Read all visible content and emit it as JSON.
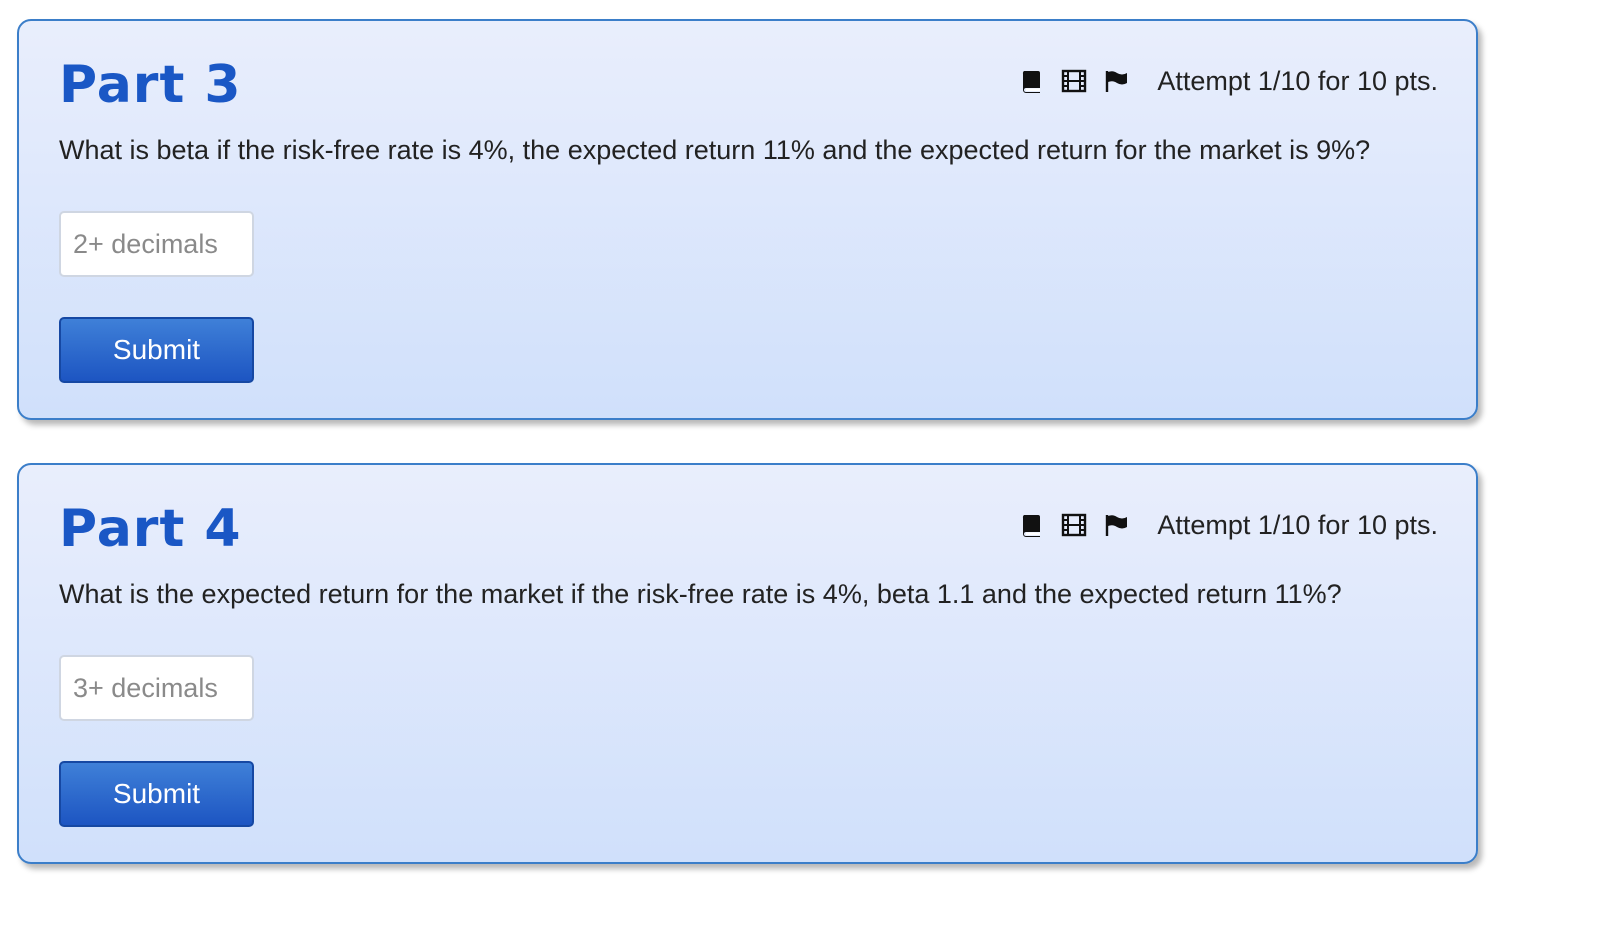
{
  "parts": [
    {
      "title": "Part 3",
      "attempt": "Attempt 1/10 for 10 pts.",
      "question": "What is beta if the risk-free rate is 4%, the expected return 11% and the expected return for the market is 9%?",
      "input": {
        "placeholder": "2+ decimals",
        "value": ""
      },
      "submit_label": "Submit",
      "icons": [
        "book-icon",
        "film-icon",
        "flag-icon"
      ]
    },
    {
      "title": "Part 4",
      "attempt": "Attempt 1/10 for 10 pts.",
      "question": "What is the expected return for the market if the risk-free rate is 4%, beta 1.1 and the expected return 11%?",
      "input": {
        "placeholder": "3+ decimals",
        "value": ""
      },
      "submit_label": "Submit",
      "icons": [
        "book-icon",
        "film-icon",
        "flag-icon"
      ]
    }
  ],
  "colors": {
    "title": "#1a57c5",
    "card_border": "#3b7ec9",
    "button": "#1d55c2"
  }
}
